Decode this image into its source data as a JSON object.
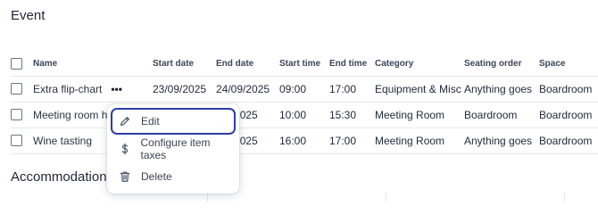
{
  "event": {
    "title": "Event",
    "columns": [
      "Name",
      "Start date",
      "End date",
      "Start time",
      "End time",
      "Category",
      "Seating order",
      "Space"
    ],
    "rows": [
      {
        "name": "Extra flip-chart",
        "start_date": "23/09/2025",
        "end_date": "24/09/2025",
        "start_time": "09:00",
        "end_time": "17:00",
        "category": "Equipment & Misc",
        "seating": "Anything goes",
        "space": "Boardroom"
      },
      {
        "name": "Meeting room hi",
        "start_date": "",
        "end_date": "/09/2025",
        "start_time": "10:00",
        "end_time": "15:30",
        "category": "Meeting Room",
        "seating": "Boardroom",
        "space": "Boardroom"
      },
      {
        "name": "Wine tasting",
        "start_date": "",
        "end_date": "/09/2025",
        "start_time": "16:00",
        "end_time": "17:00",
        "category": "Meeting Room",
        "seating": "Anything goes",
        "space": "Boardroom"
      }
    ],
    "more_label": "•••"
  },
  "accommodation": {
    "title": "Accommodation"
  },
  "menu": {
    "items": [
      {
        "label": "Edit",
        "icon": "pencil-icon"
      },
      {
        "label": "Configure item taxes",
        "icon": "dollar-icon"
      },
      {
        "label": "Delete",
        "icon": "trash-icon"
      }
    ]
  }
}
